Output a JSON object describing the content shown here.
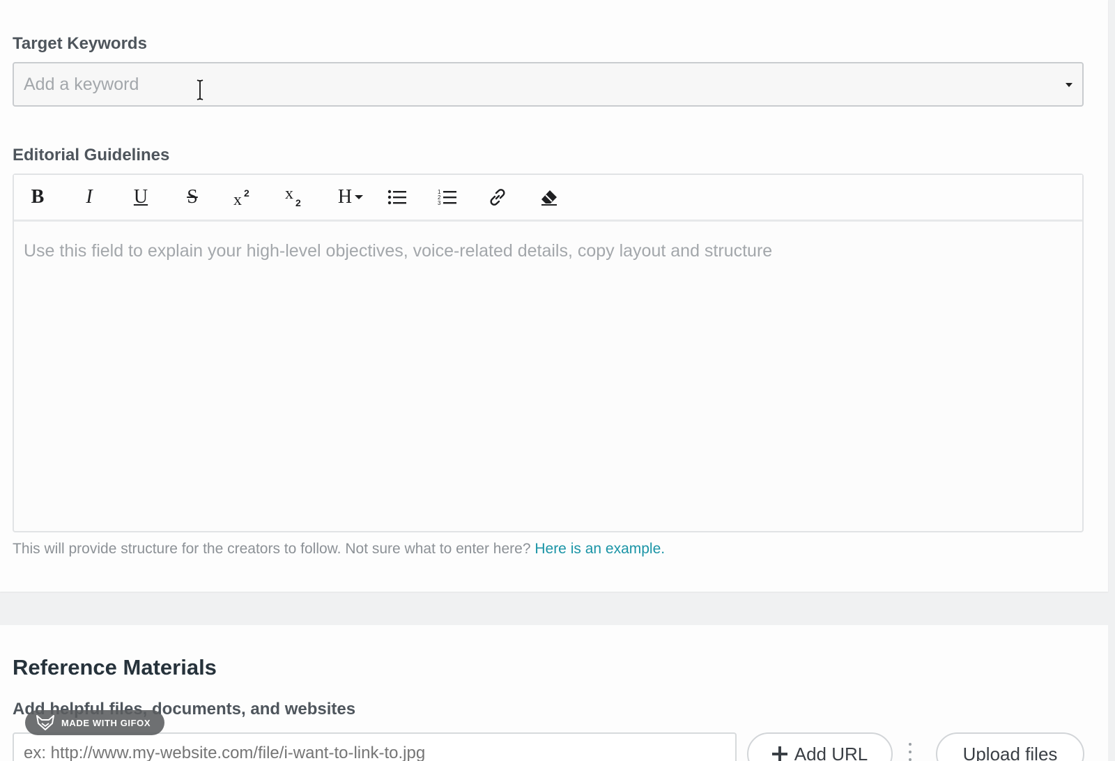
{
  "keywords": {
    "label": "Target Keywords",
    "placeholder": "Add a keyword"
  },
  "guidelines": {
    "label": "Editorial Guidelines",
    "toolbar": {
      "bold": "B",
      "italic": "I",
      "underline": "U",
      "strikethrough": "S",
      "heading": "H"
    },
    "placeholder": "Use this field to explain your high-level objectives, voice-related details, copy layout and structure",
    "help_text": "This will provide structure for the creators to follow. Not sure what to enter here? ",
    "help_link": "Here is an example."
  },
  "reference": {
    "title": "Reference Materials",
    "subtitle": "Add helpful files, documents, and websites",
    "url_placeholder": "ex: http://www.my-website.com/file/i-want-to-link-to.jpg",
    "add_url_label": "Add URL",
    "upload_label": "Upload files"
  },
  "watermark": {
    "text": "MADE WITH GIFOX"
  },
  "colors": {
    "link": "#1a94a6",
    "heading": "#26323b"
  }
}
